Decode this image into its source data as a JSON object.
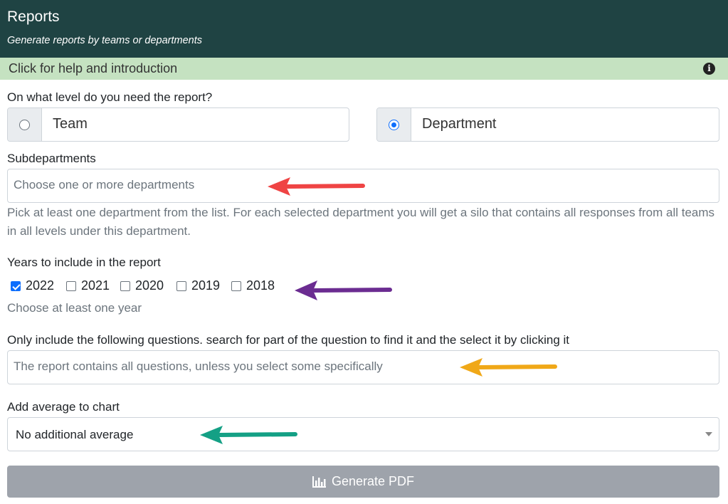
{
  "header": {
    "title": "Reports",
    "subtitle": "Generate reports by teams or departments"
  },
  "help": {
    "text": "Click for help and introduction",
    "icon": "info-icon"
  },
  "level": {
    "label": "On what level do you need the report?",
    "options": [
      {
        "label": "Team",
        "selected": false
      },
      {
        "label": "Department",
        "selected": true
      }
    ]
  },
  "subdepartments": {
    "label": "Subdepartments",
    "placeholder": "Choose one or more departments",
    "help": "Pick at least one department from the list. For each selected department you will get a silo that contains all responses from all teams in all levels under this department."
  },
  "years": {
    "label": "Years to include in the report",
    "options": [
      {
        "label": "2022",
        "checked": true
      },
      {
        "label": "2021",
        "checked": false
      },
      {
        "label": "2020",
        "checked": false
      },
      {
        "label": "2019",
        "checked": false
      },
      {
        "label": "2018",
        "checked": false
      }
    ],
    "help": "Choose at least one year"
  },
  "questions": {
    "label": "Only include the following questions. search for part of the question to find it and the select it by clicking it",
    "placeholder": "The report contains all questions, unless you select some specifically"
  },
  "average": {
    "label": "Add average to chart",
    "value": "No additional average"
  },
  "generate": {
    "label": "Generate PDF",
    "icon": "bar-chart-icon"
  },
  "annotations": {
    "colors": [
      "#ef4444",
      "#6b2c91",
      "#f0a818",
      "#14a085"
    ]
  }
}
